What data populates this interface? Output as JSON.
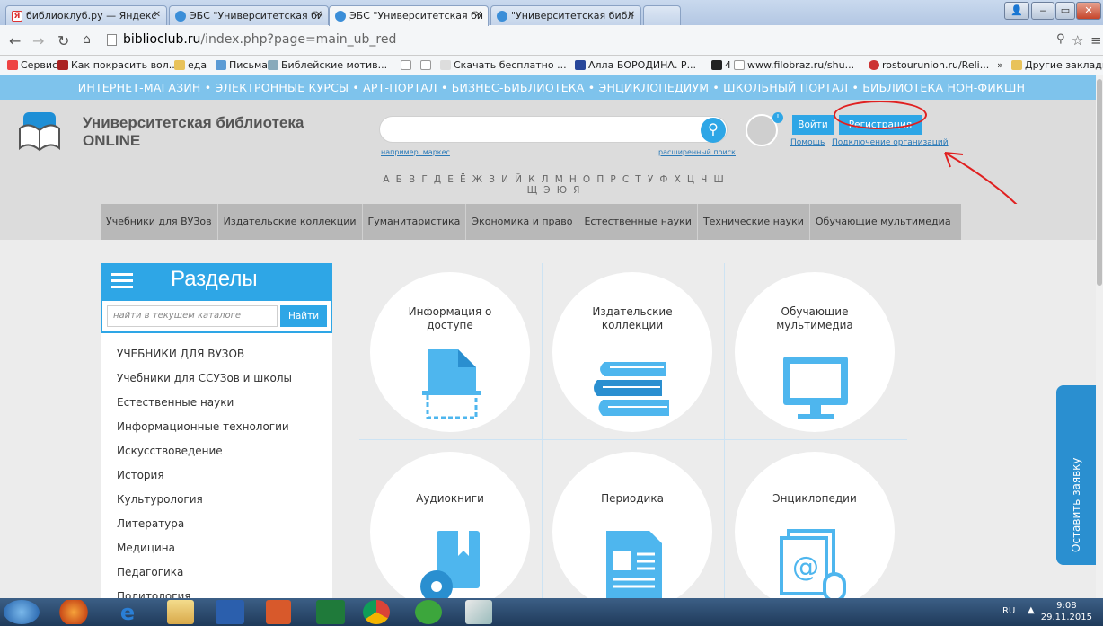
{
  "browser": {
    "tabs": [
      {
        "title": "библиоклуб.ру — Яндекс",
        "active": false
      },
      {
        "title": "ЭБС \"Университетская би",
        "active": false
      },
      {
        "title": "ЭБС \"Университетская би",
        "active": true
      },
      {
        "title": "\"Университетская библ",
        "active": false
      }
    ],
    "url_host": "biblioclub.ru",
    "url_path": "/index.php?page=main_ub_red",
    "bookmarks": [
      "Сервисы",
      "Как покрасить вол...",
      "еда",
      "Письма",
      "Библейские мотив...",
      "",
      "",
      "Скачать бесплатно ...",
      "Алла БОРОДИНА. Р...",
      "4",
      "www.filobraz.ru/shu...",
      "rostourunion.ru/Reli...",
      "Другие закладки"
    ]
  },
  "site": {
    "top_links": "ИНТЕРНЕТ-МАГАЗИН  •  ЭЛЕКТРОННЫЕ КУРСЫ  •  АРТ-ПОРТАЛ  •  БИЗНЕС-БИБЛИОТЕКА  •  ЭНЦИКЛОПЕДИУМ  •  ШКОЛЬНЫЙ ПОРТАЛ  •  БИБЛИОТЕКА НОН-ФИКШН",
    "logo_line1": "Университетская библиотека",
    "logo_line2": "ONLINE",
    "search_example": "например, маркес",
    "advanced_search": "расширенный поиск",
    "alphabet": "А Б В Г Д Е Ё Ж З И Й К Л М Н О П Р С Т У Ф Х Ц Ч Ш Щ Э Ю Я",
    "login": "Войти",
    "register": "Регистрация",
    "help": "Помощь",
    "connect_org": "Подключение организаций",
    "menu": [
      "Учебники для ВУЗов",
      "Издательские коллекции",
      "Гуманитаристика",
      "Экономика и право",
      "Естественные науки",
      "Технические науки",
      "Обучающие мультимедиа"
    ]
  },
  "sidebar": {
    "title": "Разделы",
    "catalog_placeholder": "найти в текущем каталоге",
    "find": "Найти",
    "items": [
      "УЧЕБНИКИ ДЛЯ ВУЗОВ",
      "Учебники для ССУЗов и школы",
      "Естественные науки",
      "Информационные технологии",
      "Искусствоведение",
      "История",
      "Культурология",
      "Литература",
      "Медицина",
      "Педагогика",
      "Политология"
    ]
  },
  "tiles": [
    {
      "title1": "Информация о",
      "title2": "доступе",
      "icon": "document-scan-icon"
    },
    {
      "title1": "Издательские",
      "title2": "коллекции",
      "icon": "books-stack-icon"
    },
    {
      "title1": "Обучающие",
      "title2": "мультимедиа",
      "icon": "monitor-icon"
    },
    {
      "title1": "Аудиокниги",
      "title2": "",
      "icon": "audiobook-icon"
    },
    {
      "title1": "Периодика",
      "title2": "",
      "icon": "periodical-icon"
    },
    {
      "title1": "Энциклопедии",
      "title2": "",
      "icon": "encyclopedia-icon"
    }
  ],
  "side_tab": "Оставить заявку",
  "taskbar": {
    "lang": "RU",
    "time": "9:08",
    "date": "29.11.2015"
  },
  "colors": {
    "accent": "#2ea6e6",
    "top_strip": "#7ec3ec",
    "annotation": "#e02020"
  }
}
